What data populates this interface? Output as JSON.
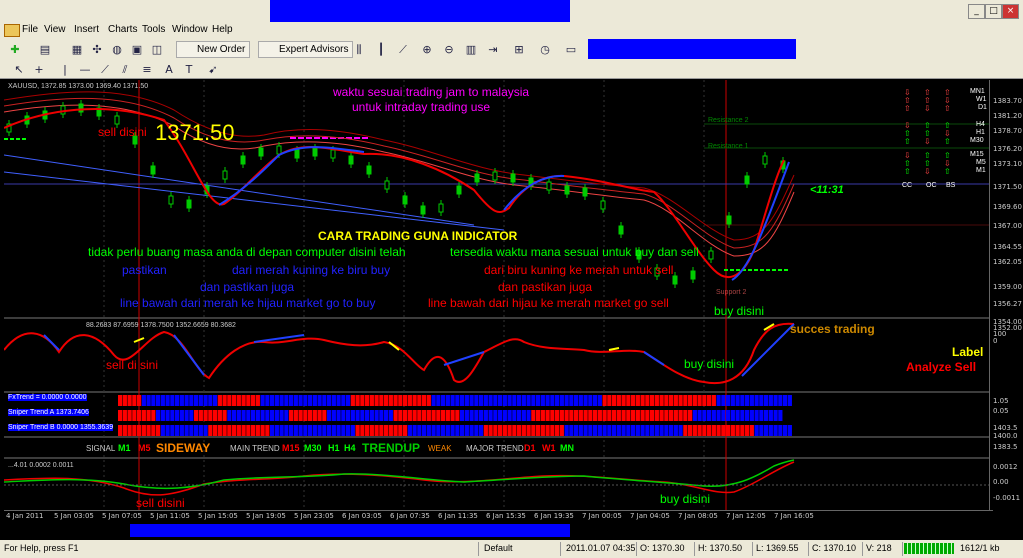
{
  "window": {
    "title_min": "_",
    "title_max": "□",
    "title_close": "×"
  },
  "menu": [
    "File",
    "View",
    "Insert",
    "Charts",
    "Tools",
    "Window",
    "Help"
  ],
  "toolbar": {
    "new_order": "New Order",
    "expert_advisors": "Expert Advisors"
  },
  "chart": {
    "symbol_line": "XAUUSD,     1372.85  1373.00  1369.40  1371.50",
    "price_big": "1371.50",
    "header_line1": "waktu sesuai trading jam                        to                   malaysia",
    "header_line2": "untuk intraday trading use",
    "sell_here_top": "sell disini",
    "timer": "<11:31",
    "title_guide": "CARA TRADING GUNA INDICATOR",
    "text_green_left": "tidak perlu buang masa anda di depan computer disini telah",
    "text_green_right": "tersedia waktu mana sesuai untuk buy dan sell",
    "text_blue_1": "pastikan",
    "text_blue_2": "dari merah kuning ke biru buy",
    "text_blue_3": "dan pastikan juga",
    "text_blue_4": "line bawah dari merah ke hijau market go to buy",
    "text_red_1": "dari biru kuning ke merah untuk sell",
    "text_red_2": "dan pastikan juga",
    "text_red_3": "line bawah dari hijau ke merah market go sell",
    "buy_here_main": "buy disini",
    "resistance2": "Resistance 2",
    "resistance1": "Resistance 1",
    "support2": "Support 2",
    "tf_labels": [
      "MN1",
      "W1",
      "D1",
      "H4",
      "H1",
      "M30",
      "M15",
      "M5",
      "M1"
    ],
    "cc_labels": [
      "CC",
      "OC",
      "BS"
    ],
    "sub1_line": "88.2683  87.6959  1378.7500  1352.6659  80.3682",
    "sub1_sell": "sell di sini",
    "sub1_buy": "buy disini",
    "succes": "succes trading",
    "label_txt": "Label",
    "analyze": "Analyze Sell",
    "trend1": "FxTrend = 0.0000  0.0000",
    "trend2": "Sniper Trend A  1373.7406",
    "trend3": "Sniper Trend B  0.0000  1355.3639",
    "signal": "SIGNAL",
    "m1": "M1",
    "m5": "M5",
    "sideway": "SIDEWAY",
    "main_trend": "MAIN TREND",
    "m15": "M15",
    "m30": "M30",
    "h1": "H1",
    "h4": "H4",
    "trendup": "TRENDUP",
    "weak": "WEAK",
    "major_trend": "MAJOR TREND",
    "d1": "D1",
    "w1": "W1",
    "mn": "MN",
    "sub3_line": "...4.01  0.0002  0.0011",
    "sell_bottom": "sell disini",
    "buy_bottom": "buy disini",
    "prices": [
      "1383.70",
      "1381.20",
      "1378.70",
      "1376.20",
      "1373.10",
      "1371.50",
      "1369.60",
      "1367.00",
      "1364.55",
      "1362.05",
      "1359.00",
      "1356.27",
      "1354.00",
      "1352.00",
      "100",
      "0",
      "1.05",
      "0.05",
      "1403.5",
      "1400.0",
      "1383.5",
      "0.0012",
      "0.00",
      "-0.0011"
    ],
    "times": [
      "4 Jan 2011",
      "5 Jan 03:05",
      "5 Jan 07:05",
      "5 Jan 11:05",
      "5 Jan 15:05",
      "5 Jan 19:05",
      "5 Jan 23:05",
      "6 Jan 03:05",
      "6 Jan 07:35",
      "6 Jan 11:35",
      "6 Jan 15:35",
      "6 Jan 19:35",
      "7 Jan 00:05",
      "7 Jan 04:05",
      "7 Jan 08:05",
      "7 Jan 12:05",
      "7 Jan 16:05"
    ]
  },
  "status": {
    "help": "For Help, press F1",
    "profile": "Default",
    "datetime": "2011.01.07 04:35",
    "open": "O: 1370.30",
    "high": "H: 1370.50",
    "low": "L: 1369.55",
    "close": "C: 1370.10",
    "volume": "V: 218",
    "traffic": "1612/1 kb"
  }
}
